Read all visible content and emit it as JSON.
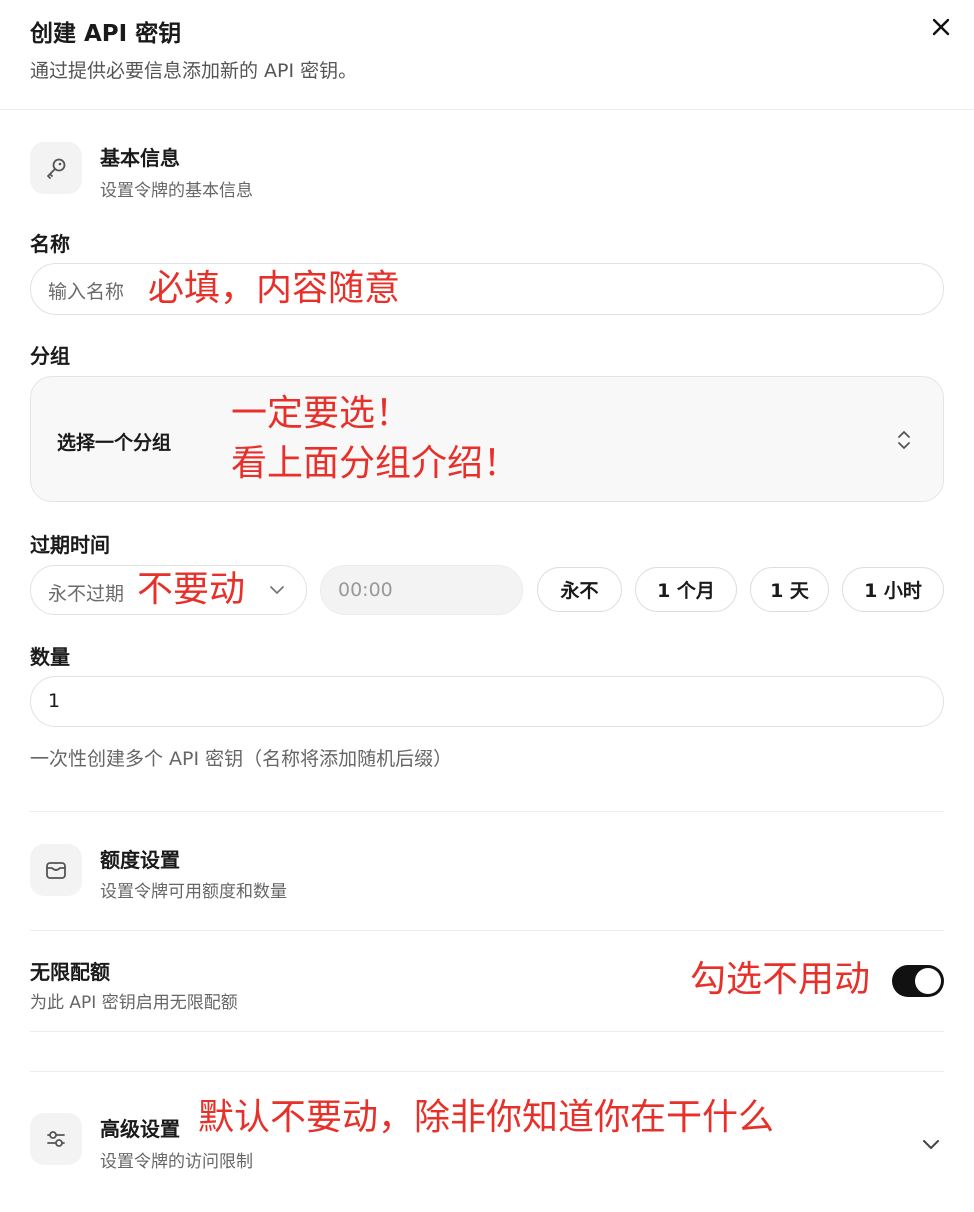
{
  "dialog": {
    "title": "创建 API 密钥",
    "subtitle": "通过提供必要信息添加新的 API 密钥。"
  },
  "basic": {
    "title": "基本信息",
    "subtitle": "设置令牌的基本信息",
    "icon": "key-icon"
  },
  "name_field": {
    "label": "名称",
    "placeholder": "输入名称"
  },
  "group_field": {
    "label": "分组",
    "value": "选择一个分组"
  },
  "expiry": {
    "label": "过期时间",
    "select_value": "永不过期",
    "time_placeholder": "00:00",
    "presets": [
      "永不",
      "1 个月",
      "1 天",
      "1 小时"
    ]
  },
  "quantity": {
    "label": "数量",
    "value": "1",
    "hint": "一次性创建多个 API 密钥（名称将添加随机后缀）"
  },
  "quota": {
    "title": "额度设置",
    "subtitle": "设置令牌可用额度和数量",
    "icon": "wallet-icon"
  },
  "unlimited": {
    "title": "无限配额",
    "subtitle": "为此 API 密钥启用无限配额",
    "enabled": true
  },
  "advanced": {
    "title": "高级设置",
    "subtitle": "设置令牌的访问限制",
    "icon": "sliders-icon"
  },
  "annotations": {
    "name": "必填，内容随意",
    "group_line1": "一定要选！",
    "group_line2": "看上面分组介绍！",
    "expiry": "不要动",
    "unlimited": "勾选不用动",
    "advanced": "默认不要动，除非你知道你在干什么"
  },
  "colors": {
    "annotation": "#e8302a",
    "toggle_on": "#111111"
  }
}
